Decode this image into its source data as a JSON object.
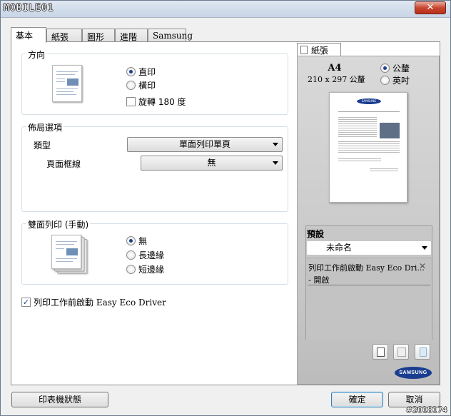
{
  "window": {
    "logo_text": "MOBILE01",
    "close_label": "✕"
  },
  "tabs": [
    {
      "label": "基本"
    },
    {
      "label": "紙張"
    },
    {
      "label": "圖形"
    },
    {
      "label": "進階"
    },
    {
      "label": "Samsung"
    }
  ],
  "orientation": {
    "title": "方向",
    "options": [
      "直印",
      "橫印"
    ],
    "selected": "直印",
    "rotate_label": "旋轉 180 度",
    "rotate_checked": false
  },
  "layout": {
    "title": "佈局選項",
    "type_label": "類型",
    "type_value": "單面列印單頁",
    "border_label": "頁面框線",
    "border_value": "無"
  },
  "duplex": {
    "title": "雙面列印 (手動)",
    "options": [
      "無",
      "長邊緣",
      "短邊緣"
    ],
    "selected": "無"
  },
  "eco": {
    "label": "列印工作前啟動 Easy Eco Driver",
    "checked": true
  },
  "paper_panel": {
    "tab_label": "紙張",
    "size_name": "A4",
    "size_dims": "210 x 297 公釐",
    "units": [
      "公釐",
      "英吋"
    ],
    "unit_selected": "公釐",
    "preview_brand": "SAMSUNG"
  },
  "preset": {
    "title": "預設",
    "value": "未命名",
    "item_title": "列印工作前啟動 Easy Eco Dri...",
    "item_value": "- 開啟"
  },
  "brand": {
    "logo": "SAMSUNG"
  },
  "footer": {
    "status_button": "印表機狀態",
    "ok_button": "確定",
    "cancel_button": "取消"
  },
  "watermark": "#2018174"
}
